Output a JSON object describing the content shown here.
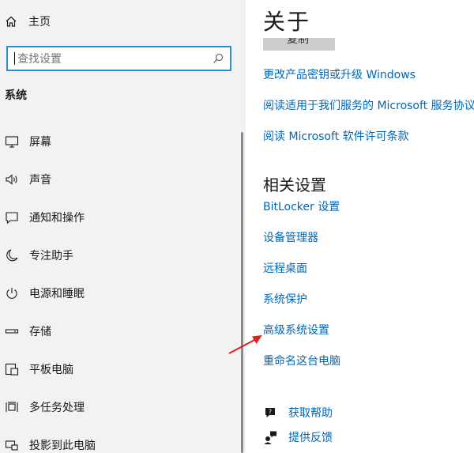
{
  "sidebar": {
    "home_label": "主页",
    "search_placeholder": "查找设置",
    "section_title": "系统",
    "items": [
      {
        "label": "屏幕",
        "icon": "monitor-icon"
      },
      {
        "label": "声音",
        "icon": "speaker-icon"
      },
      {
        "label": "通知和操作",
        "icon": "notification-icon"
      },
      {
        "label": "专注助手",
        "icon": "moon-icon"
      },
      {
        "label": "电源和睡眠",
        "icon": "power-icon"
      },
      {
        "label": "存储",
        "icon": "storage-icon"
      },
      {
        "label": "平板电脑",
        "icon": "tablet-icon"
      },
      {
        "label": "多任务处理",
        "icon": "multitask-icon"
      },
      {
        "label": "投影到此电脑",
        "icon": "projector-icon"
      }
    ]
  },
  "main": {
    "title": "关于",
    "copy_button": "复制",
    "links": [
      "更改产品密钥或升级 Windows",
      "阅读适用于我们服务的 Microsoft 服务协议",
      "阅读 Microsoft 软件许可条款"
    ],
    "related_title": "相关设置",
    "related_links": [
      "BitLocker 设置",
      "设备管理器",
      "远程桌面",
      "系统保护",
      "高级系统设置",
      "重命名这台电脑"
    ],
    "help": [
      {
        "label": "获取帮助",
        "icon": "help-icon"
      },
      {
        "label": "提供反馈",
        "icon": "feedback-icon"
      }
    ]
  },
  "colors": {
    "accent": "#0067b8",
    "sidebar_bg": "#f2f2f2",
    "search_border": "#2b8fd6",
    "annotation_arrow": "#e02020"
  }
}
